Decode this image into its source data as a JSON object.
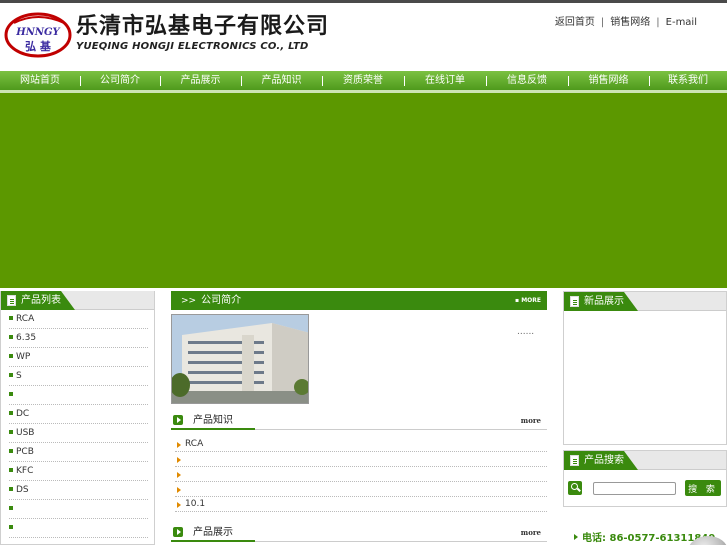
{
  "header": {
    "logo_text_top": "HNNGY",
    "logo_text_bottom": "弘  基",
    "company_name_cn": "乐清市弘基电子有限公司",
    "company_name_en": "YUEQING HONGJI ELECTRONICS CO., LTD",
    "links": [
      "返回首页",
      "销售网络",
      "E-mail"
    ]
  },
  "nav": {
    "items": [
      "网站首页",
      "公司简介",
      "产品展示",
      "产品知识",
      "资质荣誉",
      "在线订单",
      "信息反馈",
      "销售网络",
      "联系我们"
    ]
  },
  "left": {
    "title": "产品列表",
    "items": [
      "RCA",
      "6.35",
      "WP",
      "S",
      "",
      "DC",
      "USB",
      "PCB",
      "KFC",
      "DS",
      "",
      ""
    ]
  },
  "middle": {
    "intro_title": "公司简介",
    "intro_more": "MORE",
    "intro_text": "......",
    "knowledge": {
      "title": "产品知识",
      "more": "more",
      "items": [
        "RCA",
        "",
        "",
        "",
        "10.1"
      ]
    },
    "products": {
      "title": "产品展示",
      "more": "more"
    }
  },
  "right": {
    "new_title": "新品展示",
    "search_title": "产品搜索",
    "search_value": "",
    "search_button": "搜 索",
    "phone": "电话: 86-0577-61311840"
  },
  "colors": {
    "accent": "#3a8a0e",
    "banner": "#5c9800",
    "nav": "#5fa82a"
  }
}
